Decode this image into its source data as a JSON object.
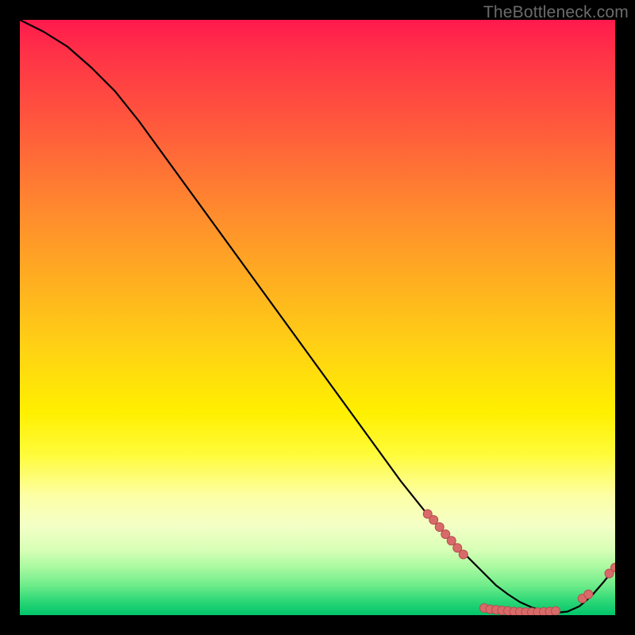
{
  "watermark": "TheBottleneck.com",
  "colors": {
    "marker_fill": "#d86a6a",
    "marker_stroke": "#b94e4e",
    "line": "#000000"
  },
  "chart_data": {
    "type": "line",
    "title": "",
    "xlabel": "",
    "ylabel": "",
    "xlim": [
      0,
      100
    ],
    "ylim": [
      0,
      100
    ],
    "grid": false,
    "series": [
      {
        "name": "bottleneck-curve",
        "x": [
          0,
          4,
          8,
          12,
          16,
          20,
          24,
          28,
          32,
          36,
          40,
          44,
          48,
          52,
          56,
          60,
          64,
          68,
          72,
          76,
          78,
          80,
          82,
          84,
          86,
          88,
          90,
          92,
          94,
          96,
          98,
          100
        ],
        "y": [
          100,
          98,
          95.5,
          92,
          88,
          83,
          77.5,
          72,
          66.5,
          61,
          55.5,
          50,
          44.5,
          39,
          33.5,
          28,
          22.5,
          17.5,
          13,
          9,
          7,
          5,
          3.5,
          2.2,
          1.3,
          0.7,
          0.4,
          0.6,
          1.5,
          3.2,
          5.5,
          8
        ]
      }
    ],
    "markers": [
      {
        "name": "cluster-descent-top",
        "x": 68.5,
        "y": 17.0
      },
      {
        "name": "cluster-descent-1",
        "x": 69.5,
        "y": 16.0
      },
      {
        "name": "cluster-descent-2",
        "x": 70.5,
        "y": 14.8
      },
      {
        "name": "cluster-descent-3",
        "x": 71.5,
        "y": 13.6
      },
      {
        "name": "cluster-descent-4",
        "x": 72.5,
        "y": 12.5
      },
      {
        "name": "cluster-descent-5",
        "x": 73.5,
        "y": 11.3
      },
      {
        "name": "cluster-descent-bottom",
        "x": 74.5,
        "y": 10.2
      },
      {
        "name": "floor-1",
        "x": 78.0,
        "y": 1.2
      },
      {
        "name": "floor-2",
        "x": 79.0,
        "y": 1.0
      },
      {
        "name": "floor-3",
        "x": 80.0,
        "y": 0.9
      },
      {
        "name": "floor-4",
        "x": 81.0,
        "y": 0.8
      },
      {
        "name": "floor-5",
        "x": 82.0,
        "y": 0.7
      },
      {
        "name": "floor-6",
        "x": 83.0,
        "y": 0.6
      },
      {
        "name": "floor-7",
        "x": 84.0,
        "y": 0.55
      },
      {
        "name": "floor-8",
        "x": 85.0,
        "y": 0.5
      },
      {
        "name": "floor-9",
        "x": 86.0,
        "y": 0.5
      },
      {
        "name": "floor-10",
        "x": 87.0,
        "y": 0.5
      },
      {
        "name": "floor-11",
        "x": 88.0,
        "y": 0.55
      },
      {
        "name": "floor-12",
        "x": 89.0,
        "y": 0.6
      },
      {
        "name": "floor-13",
        "x": 90.0,
        "y": 0.7
      },
      {
        "name": "rise-1",
        "x": 94.5,
        "y": 2.8
      },
      {
        "name": "rise-2",
        "x": 95.5,
        "y": 3.5
      },
      {
        "name": "rise-top-1",
        "x": 99.0,
        "y": 7.0
      },
      {
        "name": "rise-top-2",
        "x": 100.0,
        "y": 8.0
      }
    ]
  }
}
